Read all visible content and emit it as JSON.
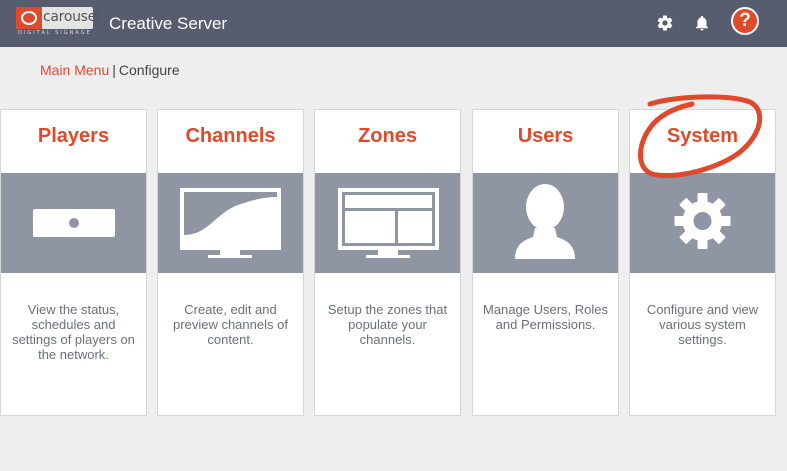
{
  "header": {
    "logo_text": "carousel",
    "logo_subtext": "DIGITAL SIGNAGE",
    "app_title": "Creative Server",
    "settings_icon": "gear-icon",
    "notifications_icon": "bell-icon",
    "help_label": "?"
  },
  "breadcrumb": {
    "main_menu": "Main Menu",
    "separator": "|",
    "current": "Configure"
  },
  "cards": [
    {
      "title": "Players",
      "icon": "player-device-icon",
      "description": "View the status, schedules and settings of players on the network."
    },
    {
      "title": "Channels",
      "icon": "monitor-channel-icon",
      "description": "Create, edit and preview channels of content."
    },
    {
      "title": "Zones",
      "icon": "monitor-zones-icon",
      "description": "Setup the zones that populate your channels."
    },
    {
      "title": "Users",
      "icon": "user-silhouette-icon",
      "description": "Manage Users, Roles and Permissions."
    },
    {
      "title": "System",
      "icon": "gear-icon",
      "description": "Configure and view various system settings."
    }
  ],
  "colors": {
    "header_bg": "#575c6e",
    "accent": "#e04a2c",
    "icon_band": "#8f95a3",
    "page_bg": "#eeeeee"
  }
}
